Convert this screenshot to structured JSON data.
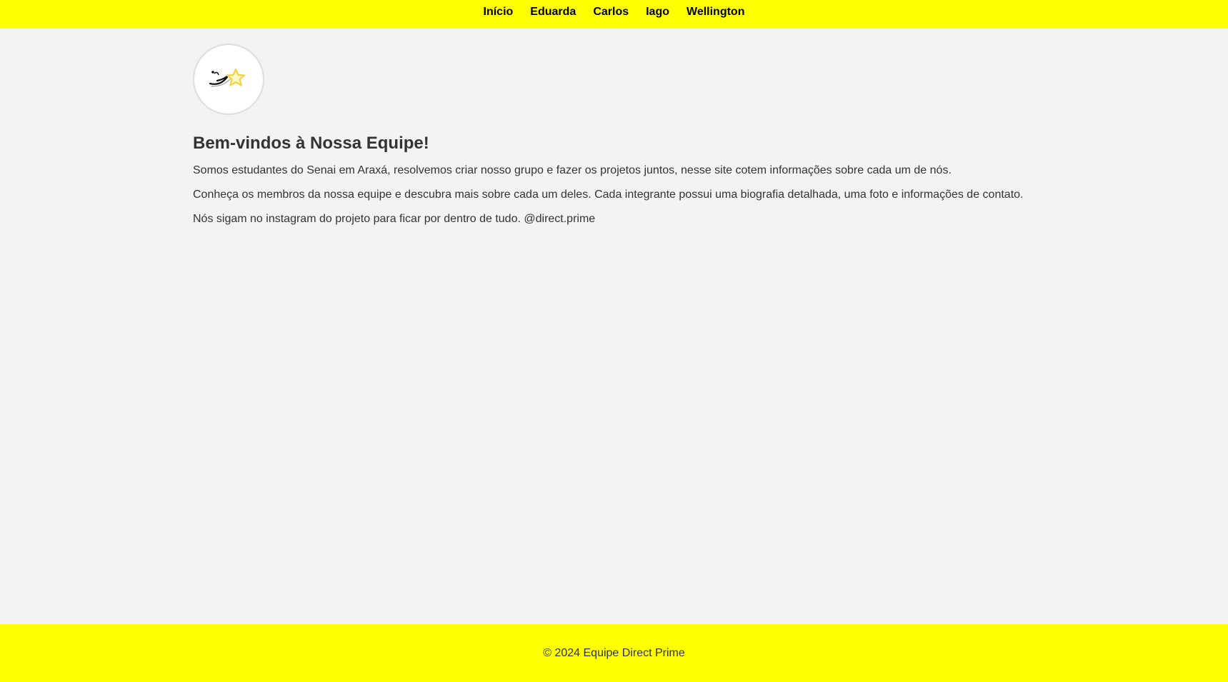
{
  "nav": {
    "items": [
      {
        "label": "Início"
      },
      {
        "label": "Eduarda"
      },
      {
        "label": "Carlos"
      },
      {
        "label": "Iago"
      },
      {
        "label": "Wellington"
      }
    ]
  },
  "logo": {
    "icon": "star-logo-icon",
    "colors": {
      "star": "#f2d24a",
      "swoosh": "#111111"
    }
  },
  "main": {
    "title": "Bem-vindos à Nossa Equipe!",
    "paragraphs": [
      "Somos estudantes do Senai em Araxá, resolvemos criar nosso grupo e fazer os projetos juntos, nesse site cotem informações sobre cada um de nós.",
      "Conheça os membros da nossa equipe e descubra mais sobre cada um deles. Cada integrante possui uma biografia detalhada, uma foto e informações de contato.",
      "Nós sigam no instagram do projeto para ficar por dentro de tudo. @direct.prime"
    ]
  },
  "footer": {
    "text": "© 2024 Equipe Direct Prime"
  },
  "colors": {
    "accent": "#ffff00",
    "background": "#f3f3f3",
    "text": "#333333"
  }
}
